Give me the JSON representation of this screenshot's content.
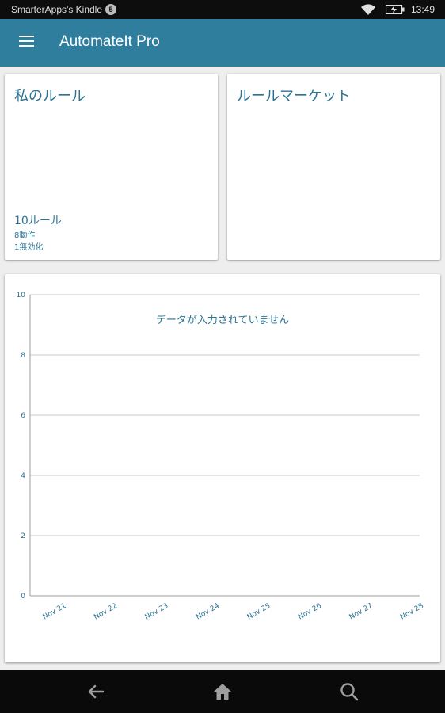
{
  "status_bar": {
    "device_name": "SmarterApps's Kindle",
    "notification_count": "5",
    "time": "13:49"
  },
  "app_bar": {
    "title": "AutomateIt Pro",
    "menu_icon": "hamburger-menu-icon"
  },
  "my_rules_card": {
    "title": "私のルール",
    "rule_count": "10ルール",
    "active_count": "8動作",
    "disabled_count": "1無効化"
  },
  "market_card": {
    "title": "ルールマーケット"
  },
  "chart_data": {
    "type": "line",
    "title": "",
    "no_data_text": "データが入力されていません",
    "xlabel": "",
    "ylabel": "",
    "categories": [
      "Nov 21",
      "Nov 22",
      "Nov 23",
      "Nov 24",
      "Nov 25",
      "Nov 26",
      "Nov 27",
      "Nov 28"
    ],
    "y_ticks": [
      "0",
      "2",
      "4",
      "6",
      "8",
      "10"
    ],
    "ylim": [
      0,
      10
    ],
    "series": [],
    "grid": true,
    "colors": {
      "text": "#2a7394",
      "grid": "#c8c8c8",
      "axis": "#9e9e9e"
    }
  },
  "nav_bar": {
    "back_icon": "back-arrow-icon",
    "home_icon": "home-icon",
    "search_icon": "search-icon"
  },
  "colors": {
    "app_bar": "#2f7e9e",
    "accent_text": "#2a7394",
    "background": "#eeeeee"
  }
}
